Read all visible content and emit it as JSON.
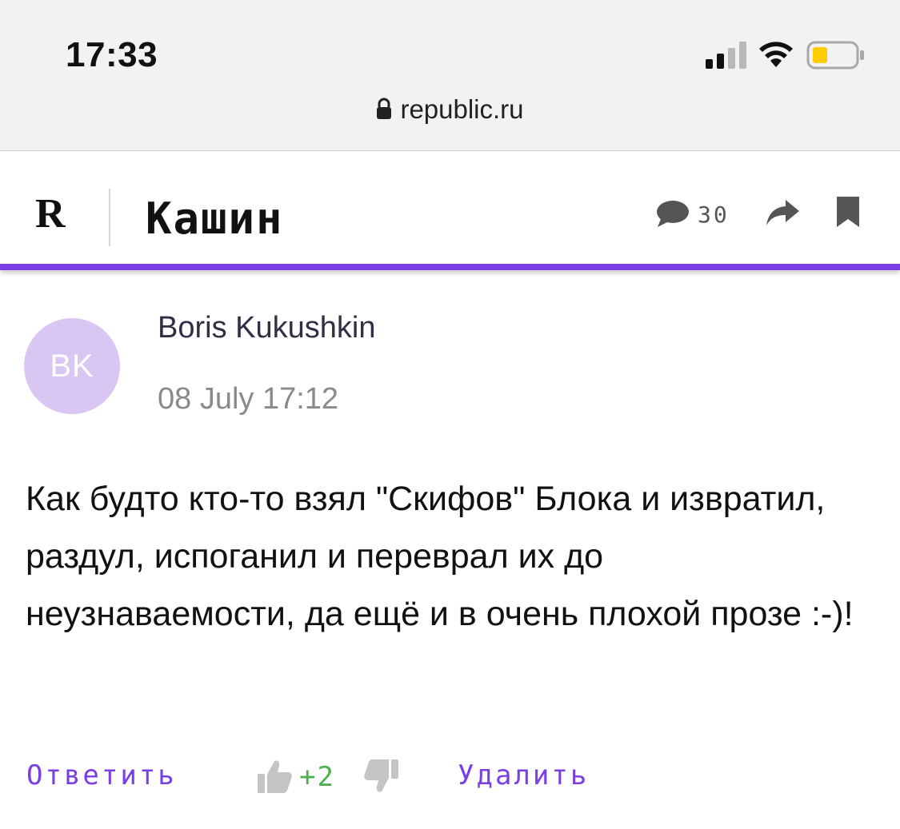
{
  "status_bar": {
    "time": "17:33",
    "signal_icon": "cellular-signal-icon",
    "wifi_icon": "wifi-icon",
    "battery_icon": "battery-low-icon",
    "battery_color": "#ffcc00"
  },
  "browser": {
    "url": "republic.ru",
    "lock_icon": "lock-icon"
  },
  "header": {
    "logo": "R",
    "section_title": "Кашин",
    "comments_icon": "speech-bubble-icon",
    "comments_count": "30",
    "share_icon": "share-arrow-icon",
    "bookmark_icon": "bookmark-icon",
    "accent_color": "#7a3fe4"
  },
  "comment": {
    "avatar_initials": "BK",
    "avatar_color": "#d9c6f3",
    "author": "Boris Kukushkin",
    "date": "08 July 17:12",
    "text": "Как будто кто-то взял \"Скифов\" Блока и извратил, раздул, испоганил и переврал их до неузнаваемости, да ещё и в очень плохой прозе :-)!"
  },
  "actions": {
    "reply_label": "Ответить",
    "like_icon": "thumbs-up-icon",
    "score": "+2",
    "score_color": "#4caf50",
    "dislike_icon": "thumbs-down-icon",
    "delete_label": "Удалить"
  }
}
